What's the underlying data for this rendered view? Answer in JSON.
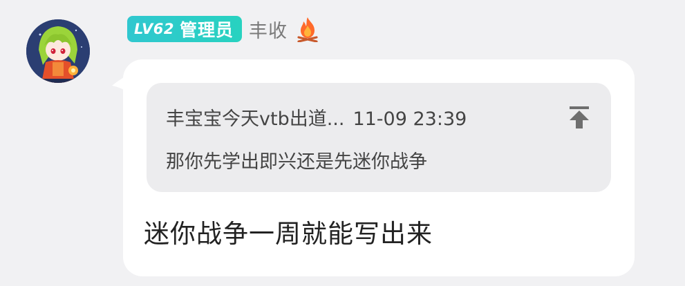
{
  "sender": {
    "avatar_icon": "anime-girl-avatar-icon",
    "level": "LV62",
    "role": "管理员",
    "name": "丰收",
    "status_icon": "fire-icon",
    "badge_color": "#2ecdc8"
  },
  "quote": {
    "author": "丰宝宝今天vtb出道...",
    "time": "11-09 23:39",
    "text": "那你先学出即兴还是先迷你战争",
    "jump_icon": "jump-to-top-icon"
  },
  "message": {
    "text": "迷你战争一周就能写出来"
  }
}
